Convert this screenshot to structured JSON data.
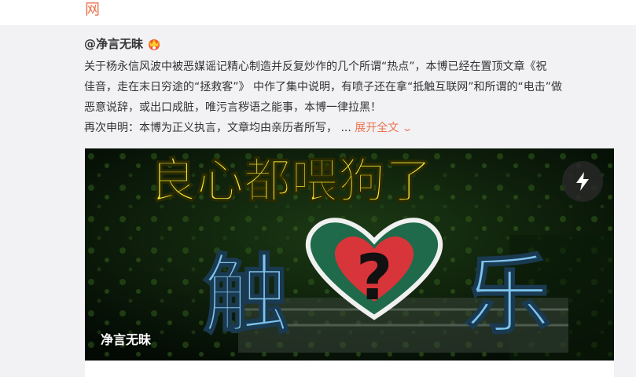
{
  "top_card": {
    "tail_text": "网"
  },
  "post": {
    "author": "@净言无昧",
    "author_badge_icon": "gold-crown-badge-icon",
    "body_lines": [
      "关于杨永信风波中被恶媒谣记精心制造并反复炒作的几个所谓“热点”，本博已经在置顶文章《祝",
      "佳音，走在末日穷途的“拯救客”》 中作了集中说明，有喷子还在拿“抵触互联网”和所谓的“电击”做",
      "恶意说辞，或出口成脏，唯污言秽语之能事，本博一律拉黑！",
      "再次申明：本博为正义执言，文章均由亲历者所写， ... "
    ],
    "expand_label": "展开全文",
    "expand_icon": "chevron-down-icon"
  },
  "media": {
    "headline": "良心都喂狗了",
    "left_char": "触",
    "right_char": "乐",
    "heart_mark": "?",
    "author_overlay": "净言无昧",
    "flash_icon": "lightning-icon"
  },
  "colors": {
    "accent": "#eb7350",
    "headline_yellow": "#f2ea3c",
    "char_blue": "#7ec4ec",
    "heart_green": "#1f6a4a",
    "heart_red": "#d8353a"
  }
}
